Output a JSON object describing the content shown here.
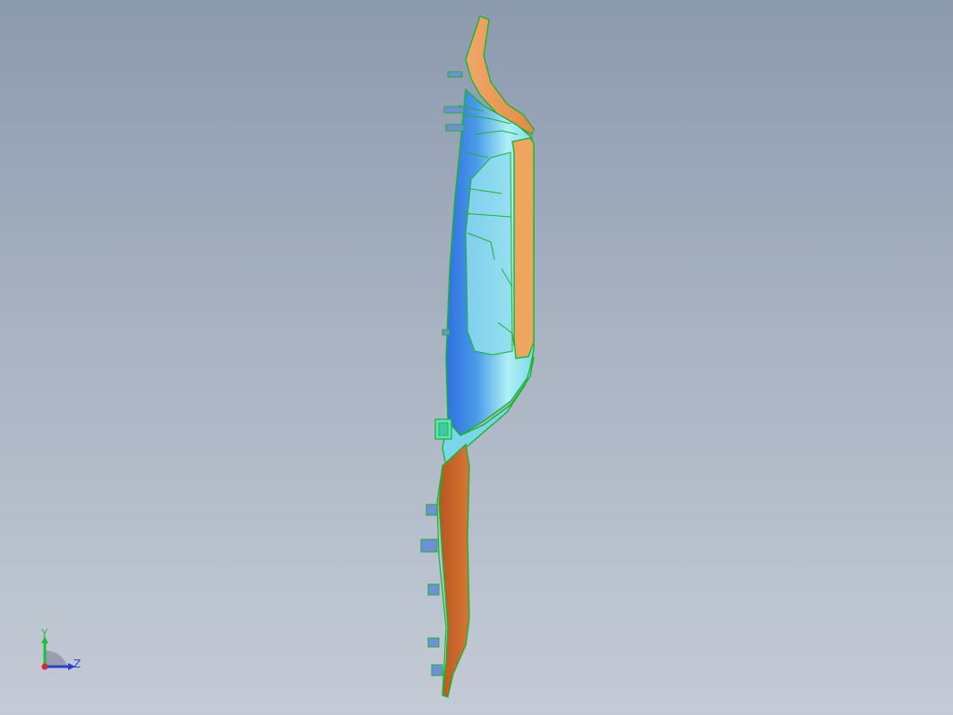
{
  "viewport": {
    "background_top": "#8c9aae",
    "background_bottom": "#c4cbd6"
  },
  "model": {
    "outline_color": "#19b52e",
    "surface_orange": "#e8995a",
    "surface_dark_orange": "#c5662e",
    "surface_blue": "#4a8be6",
    "surface_cyan": "#9fe6f2",
    "boss_color": "#6f8fd8"
  },
  "triad": {
    "y_label": "Y",
    "z_label": "Z",
    "y_color": "#1fbf3a",
    "z_color": "#2b3fd8",
    "x_color": "#d8262b"
  }
}
